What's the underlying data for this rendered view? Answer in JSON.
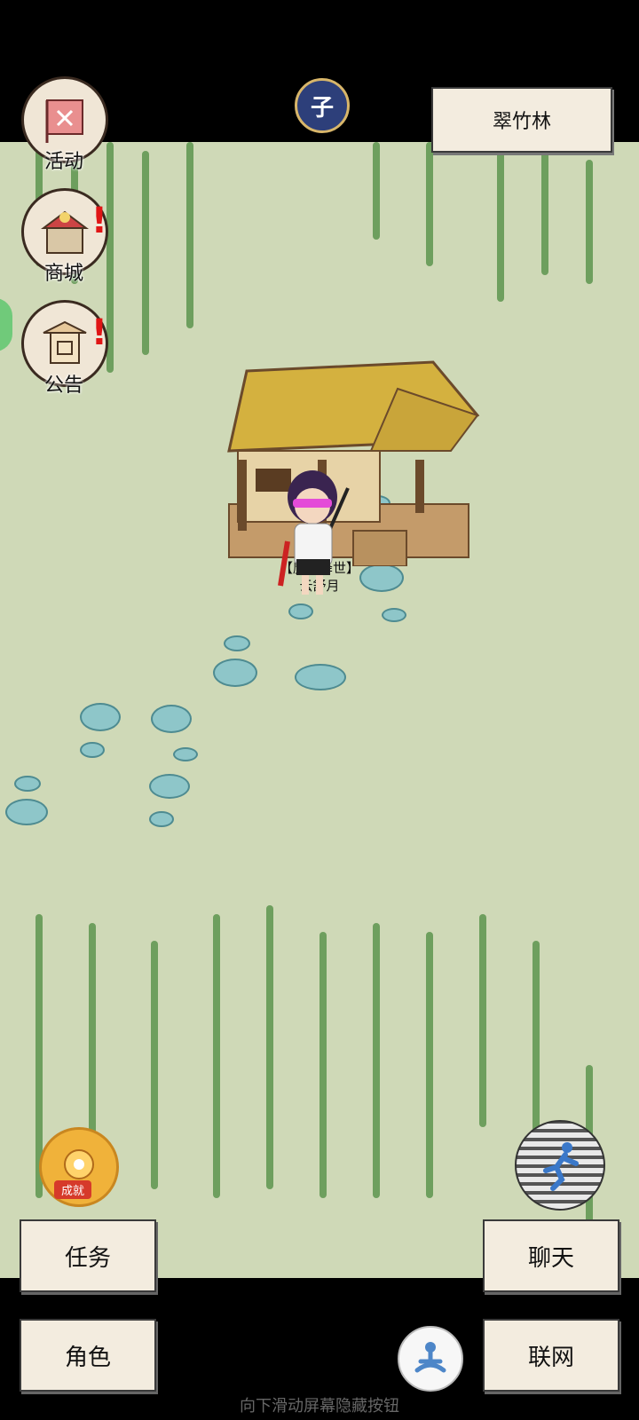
{
  "location": {
    "name": "翠竹林"
  },
  "time": {
    "symbol": "子"
  },
  "left_menu": [
    {
      "label": "活动",
      "icon": "banner-icon",
      "alert": false
    },
    {
      "label": "商城",
      "icon": "shop-icon",
      "alert": true
    },
    {
      "label": "公告",
      "icon": "notice-board-icon",
      "alert": true
    }
  ],
  "player": {
    "title": "【魔童降世】",
    "name": "云舒月"
  },
  "achievement": {
    "label": "成就"
  },
  "buttons": {
    "tasks": "任务",
    "chat": "聊天",
    "character": "角色",
    "network": "联网"
  },
  "hint": "向下滑动屏幕隐藏按钮",
  "colors": {
    "ground": "#cfd9b7",
    "panel": "#f3ecdf",
    "alert": "#e01515",
    "bamboo": "#6e9f5e",
    "stone": "#8ec6c9"
  }
}
